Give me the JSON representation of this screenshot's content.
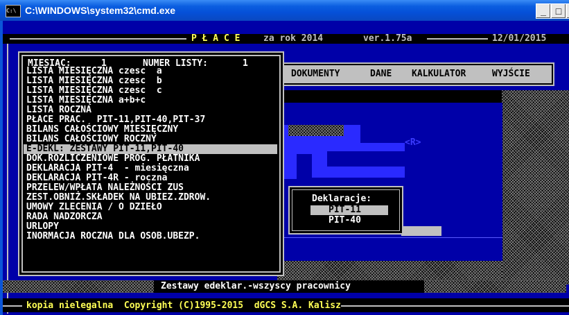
{
  "window": {
    "title": "C:\\WINDOWS\\system32\\cmd.exe",
    "icon": "cmd-icon",
    "controls": [
      "_",
      "□",
      "×"
    ]
  },
  "header": {
    "app_name": "P Ł A C E",
    "year_text": "za rok 2014",
    "version": "ver.1.75a",
    "date": "12/01/2015"
  },
  "topmenu": {
    "items": [
      "DOKUMENTY",
      "DANE",
      "KALKULATOR",
      "WYJŚCIE"
    ]
  },
  "dropdown": {
    "month_label": "MIESIĄC:",
    "month_value": "1",
    "list_label": "NUMER LISTY:",
    "list_value": "1",
    "items": [
      "LISTA MIESIĘCZNA czesc  a",
      "LISTA MIESIĘCZNA czesc  b",
      "LISTA MIESIĘCZNA czesc  c",
      "LISTA MIESIĘCZNA a+b+c",
      "LISTA ROCZNA",
      "PŁACE PRAC.  PIT-11,PIT-40,PIT-37",
      "BILANS CAŁOŚCIOWY MIESIĘCZNY",
      "BILANS CAŁOŚCIOWY ROCZNY",
      "E-DEKL: ZESTAWY PIT-11,PIT-40",
      "DOK.ROZLICZENIOWE PROG. PŁATNIKA",
      "DEKLARACJA PIT-4  - miesięczna",
      "DEKLARACJA PIT-4R - roczna",
      "PRZELEW/WPŁATA NALEŻNOŚCI ZUS",
      "ZEST.OBNIŻ.SKŁADEK NA UBIEZ.ZDROW.",
      "UMOWY ZLECENIA / O DZIEŁO",
      "RADA NADZORCZA",
      "URLOPY",
      "INORMACJA ROCZNA DLA OSOB.UBEZP."
    ],
    "selected_index": 8
  },
  "background_marker": "<R>",
  "popup": {
    "title": "Deklaracje:",
    "options": [
      "PIT-11",
      "PIT-40"
    ],
    "selected_index": 0
  },
  "status_line": "Zestawy edeklar.-wszyscy pracownicy",
  "footer": "kopia nielegalna  Copyright (C)1995-2015  dGCS S.A. Kalisz",
  "colors": {
    "screen_bg": "#0000a8",
    "menu_bg": "#000000",
    "highlight": "#c0c0c0",
    "bright_blue": "#2a2aff"
  }
}
